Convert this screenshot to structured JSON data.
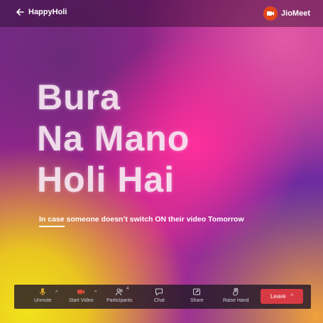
{
  "header": {
    "meeting_name": "HappyHoli",
    "brand_name": "JioMeet"
  },
  "main": {
    "headline_lines": [
      "Bura",
      "Na Mano",
      "Holi Hai"
    ],
    "subtitle": "In case someone doesn’t switch ON their video Tomorrow"
  },
  "toolbar": {
    "unmute_label": "Unmute",
    "start_video_label": "Start Video",
    "participants_label": "Participants",
    "participants_count": "4",
    "chat_label": "Chat",
    "share_label": "Share",
    "raise_hand_label": "Raise Hand",
    "leave_label": "Leave",
    "muted_icon_color": "#d4a52a",
    "video_off_icon_color": "#d84a3a",
    "leave_color": "#d83a44"
  },
  "icons": [
    "back-arrow-icon",
    "jiomeet-logo-icon",
    "microphone-muted-icon",
    "video-camera-off-icon",
    "participants-icon",
    "chat-icon",
    "share-icon",
    "raise-hand-icon",
    "chevron-up-icon"
  ]
}
